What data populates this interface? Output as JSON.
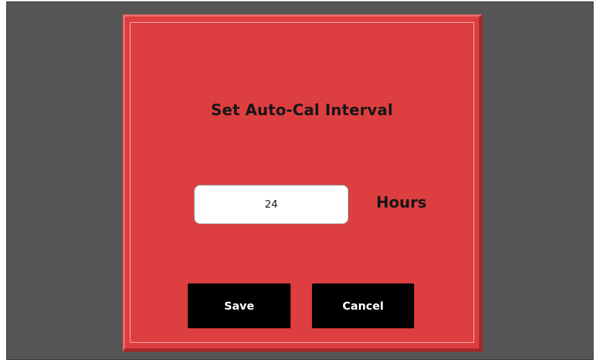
{
  "dialog": {
    "title": "Set Auto-Cal Interval",
    "interval_value": "24",
    "units_label": "Hours",
    "save_label": "Save",
    "cancel_label": "Cancel"
  },
  "colors": {
    "dialog_background": "#dd3e40",
    "screen_background": "#555555",
    "button_background": "#000000",
    "button_text": "#ffffff",
    "input_background": "#ffffff"
  }
}
